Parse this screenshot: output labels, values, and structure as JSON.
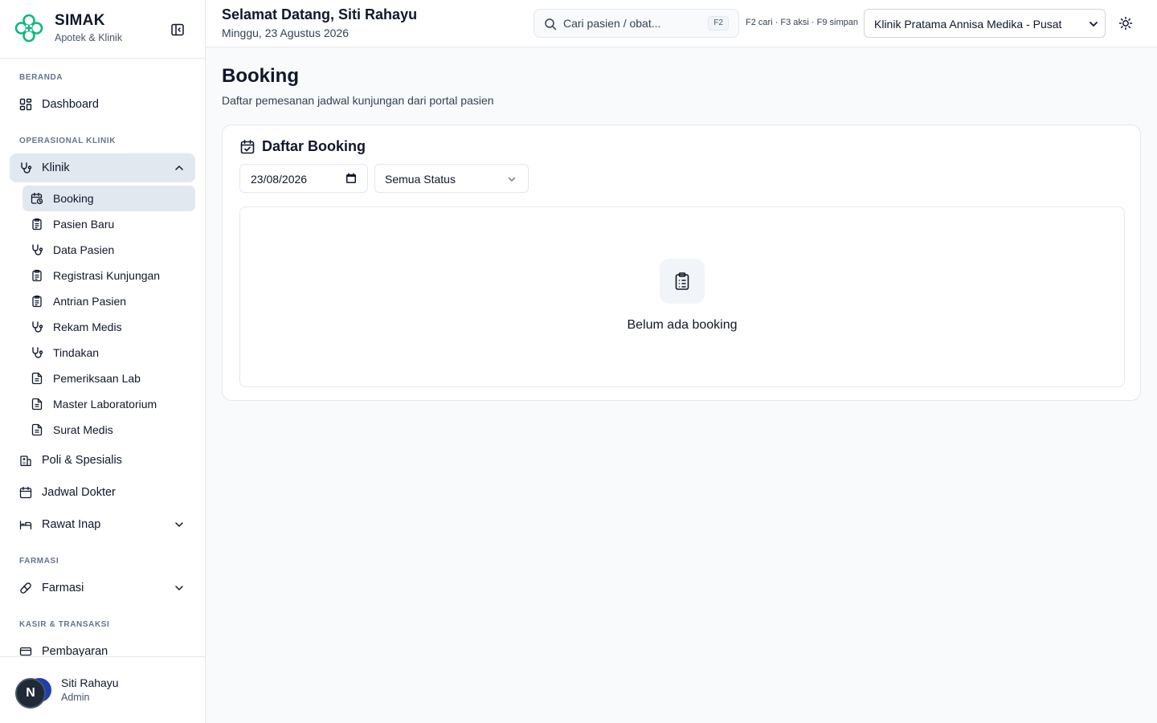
{
  "brand": {
    "name": "SIMAK",
    "subtitle": "Apotek & Klinik"
  },
  "sidebar": {
    "sections": {
      "beranda": "BERANDA",
      "operasional": "OPERASIONAL KLINIK",
      "farmasi": "FARMASI",
      "kasir": "KASIR & TRANSAKSI"
    },
    "items": {
      "dashboard": "Dashboard",
      "klinik": "Klinik",
      "poli": "Poli & Spesialis",
      "jadwal": "Jadwal Dokter",
      "rawat_inap": "Rawat Inap",
      "farmasi": "Farmasi",
      "pembayaran": "Pembayaran"
    },
    "klinik_sub": [
      "Booking",
      "Pasien Baru",
      "Data Pasien",
      "Registrasi Kunjungan",
      "Antrian Pasien",
      "Rekam Medis",
      "Tindakan",
      "Pemeriksaan Lab",
      "Master Laboratorium",
      "Surat Medis"
    ],
    "active_item": "Booking"
  },
  "user": {
    "initial": "N",
    "name": "Siti Rahayu",
    "role": "Admin"
  },
  "header": {
    "greeting": "Selamat Datang, Siti Rahayu",
    "date": "Minggu, 23 Agustus 2026",
    "search_placeholder": "Cari pasien / obat...",
    "search_kbd": "F2",
    "hotkeys": "F2 cari · F3 aksi · F9 simpan",
    "clinic": "Klinik Pratama Annisa Medika - Pusat"
  },
  "page": {
    "title": "Booking",
    "subtitle": "Daftar pemesanan jadwal kunjungan dari portal pasien"
  },
  "card": {
    "title": "Daftar Booking",
    "date_value": "23/08/2026",
    "status_value": "Semua Status",
    "empty_text": "Belum ada booking"
  },
  "colors": {
    "active_bg": "#e2e8f0",
    "brand_green": "#10b981",
    "border": "#e2e8f0"
  }
}
